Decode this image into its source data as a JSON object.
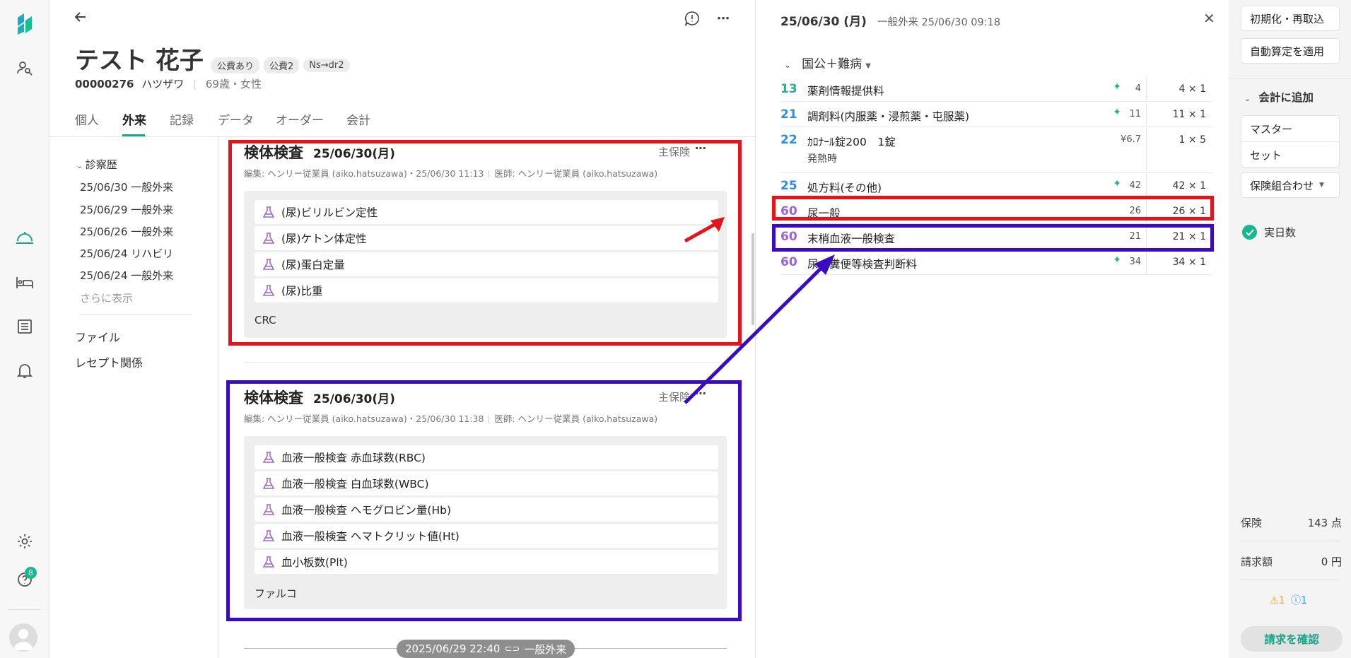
{
  "nav": {
    "help_badge": "8"
  },
  "patient": {
    "name": "テスト 花子",
    "chips": [
      "公費あり",
      "公費2",
      "Ns→dr2"
    ],
    "id": "00000276",
    "kana": "ハツザワ",
    "age_sex": "69歳・女性"
  },
  "tabs": [
    "個人",
    "外来",
    "記録",
    "データ",
    "オーダー",
    "会計"
  ],
  "history": {
    "heading": "診察歴",
    "items": [
      "25/06/30 一般外来",
      "25/06/29 一般外来",
      "25/06/26 一般外来",
      "25/06/24 リハビリ",
      "25/06/24 一般外来"
    ],
    "more": "さらに表示",
    "links": [
      "ファイル",
      "レセプト関係"
    ]
  },
  "cards": [
    {
      "title": "検体検査",
      "date": "25/06/30(月)",
      "insurance": "主保険",
      "editor": "編集: ヘンリー従業員 (aiko.hatsuzawa)・25/06/30 11:13",
      "doctor": "医師: ヘンリー従業員 (aiko.hatsuzawa)",
      "items": [
        "(尿)ビリルビン定性",
        "(尿)ケトン体定性",
        "(尿)蛋白定量",
        "(尿)比重"
      ],
      "footer": "CRC"
    },
    {
      "title": "検体検査",
      "date": "25/06/30(月)",
      "insurance": "主保険",
      "editor": "編集: ヘンリー従業員 (aiko.hatsuzawa)・25/06/30 11:38",
      "doctor": "医師: ヘンリー従業員 (aiko.hatsuzawa)",
      "items": [
        "血液一般検査 赤血球数(RBC)",
        "血液一般検査 白血球数(WBC)",
        "血液一般検査 ヘモグロビン量(Hb)",
        "血液一般検査 ヘマトクリット値(Ht)",
        "血小板数(Plt)"
      ],
      "footer": "ファルコ"
    }
  ],
  "timeline": {
    "date": "2025/06/29 22:40",
    "type": "一般外来"
  },
  "panel": {
    "date": "25/06/30 (月)",
    "subtitle": "一般外来 25/06/30 09:18",
    "group": "国公＋難病",
    "rows": [
      {
        "code": "13",
        "color": "#1fb38f",
        "name": "薬剤情報提供料",
        "ai": true,
        "points": "4",
        "qty": "4 × 1"
      },
      {
        "code": "21",
        "color": "#2a8fe0",
        "name": "調剤料(内服薬・浸煎薬・屯服薬)",
        "ai": true,
        "points": "11",
        "qty": "11 × 1"
      },
      {
        "code": "22",
        "color": "#2a8fe0",
        "name": "ｶﾛﾅｰﾙ錠200　1錠",
        "sub": "発熱時",
        "ai": false,
        "points": "¥6.7",
        "qty": "1 × 5"
      },
      {
        "code": "25",
        "color": "#2a8fe0",
        "name": "処方料(その他)",
        "ai": true,
        "points": "42",
        "qty": "42 × 1"
      },
      {
        "code": "60",
        "color": "#a062d8",
        "name": "尿一般",
        "ai": false,
        "points": "26",
        "qty": "26 × 1"
      },
      {
        "code": "60",
        "color": "#a062d8",
        "name": "末梢血液一般検査",
        "ai": false,
        "points": "21",
        "qty": "21 × 1"
      },
      {
        "code": "60",
        "color": "#a062d8",
        "name": "尿・糞便等検査判断料",
        "ai": true,
        "points": "34",
        "qty": "34 × 1"
      }
    ]
  },
  "side": {
    "reset": "初期化・再取込",
    "auto": "自動算定を適用",
    "add_heading": "会計に追加",
    "master": "マスター",
    "set": "セット",
    "combo": "保険組合わせ",
    "actual_days": "実日数",
    "insurance_label": "保険",
    "insurance_value": "143 点",
    "billing_label": "請求額",
    "billing_value": "0 円",
    "warn_count": "1",
    "info_count": "1",
    "confirm": "請求を確認"
  }
}
